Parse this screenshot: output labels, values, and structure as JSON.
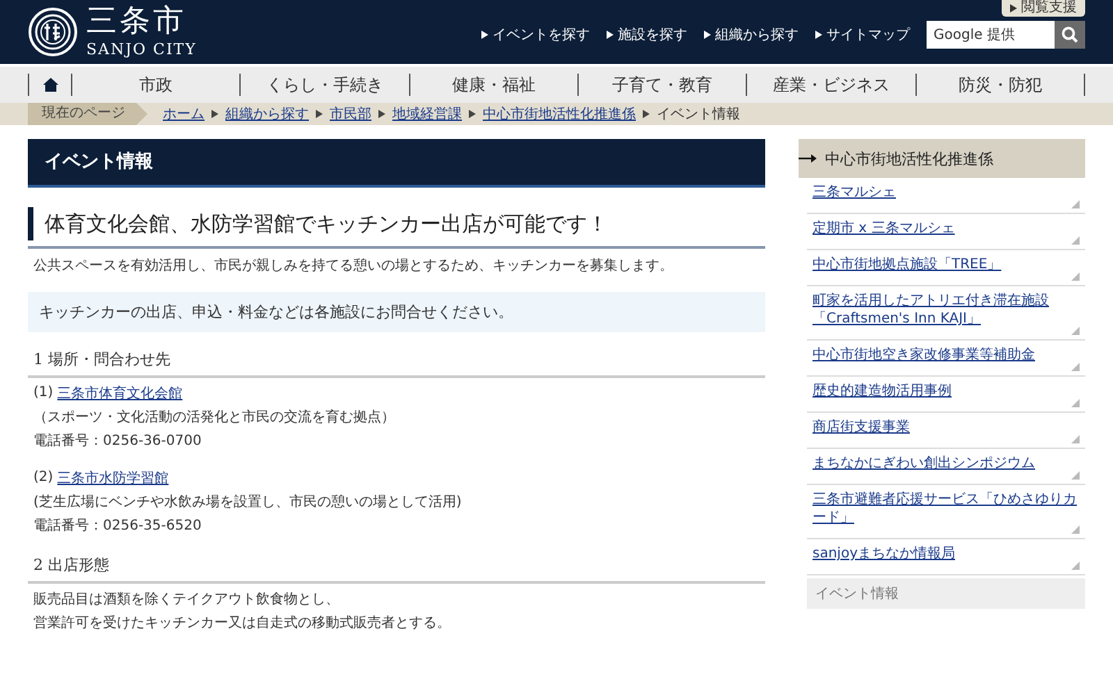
{
  "header": {
    "city_name": "三条市",
    "city_name_roman": "SANJO CITY",
    "assist_button": "閲覧支援",
    "links": [
      "イベントを探す",
      "施設を探す",
      "組織から探す",
      "サイトマップ"
    ],
    "search": {
      "placeholder": "Google 提供"
    }
  },
  "nav": {
    "items": [
      {
        "kind": "home"
      },
      {
        "kind": "text",
        "label": "市政"
      },
      {
        "kind": "text",
        "label": "くらし・手続き"
      },
      {
        "kind": "text",
        "label": "健康・福祉"
      },
      {
        "kind": "text",
        "label": "子育て・教育"
      },
      {
        "kind": "text",
        "label": "産業・ビジネス"
      },
      {
        "kind": "text",
        "label": "防災・防犯"
      }
    ]
  },
  "breadcrumb": {
    "label": "現在のページ",
    "links": [
      "ホーム",
      "組織から探す",
      "市民部",
      "地域経営課",
      "中心市街地活性化推進係"
    ],
    "current": "イベント情報"
  },
  "article": {
    "page_title": "イベント情報",
    "heading": "体育文化会館、水防学習館でキッチンカー出店が可能です！",
    "intro": "公共スペースを有効活用し、市民が親しみを持てる憩いの場とするため、キッチンカーを募集します。",
    "notice": "キッチンカーの出店、申込・料金などは各施設にお問合せください。",
    "sections": [
      {
        "heading": "1 場所・問合わせ先",
        "lines": [
          {
            "kind": "link",
            "prefix": "(1)",
            "text": "三条市体育文化会館"
          },
          {
            "kind": "text",
            "text": "（スポーツ・文化活動の活発化と市民の交流を育む拠点）"
          },
          {
            "kind": "text",
            "text": "電話番号：0256-36-0700"
          },
          {
            "kind": "gap"
          },
          {
            "kind": "link",
            "prefix": "(2)",
            "text": "三条市水防学習館"
          },
          {
            "kind": "text",
            "text": "(芝生広場にベンチや水飲み場を設置し、市民の憩いの場として活用)"
          },
          {
            "kind": "text",
            "text": "電話番号：0256-35-6520"
          }
        ]
      },
      {
        "heading": "2 出店形態",
        "lines": [
          {
            "kind": "text",
            "text": "販売品目は酒類を除くテイクアウト飲食物とし、"
          },
          {
            "kind": "text",
            "text": "営業許可を受けたキッチンカー又は自走式の移動式販売者とする。"
          }
        ]
      }
    ]
  },
  "sidebar": {
    "title": "中心市街地活性化推進係",
    "items": [
      "三条マルシェ",
      "定期市 x 三条マルシェ",
      "中心市街地拠点施設「TREE」",
      "町家を活用したアトリエ付き滞在施設「Craftsmen's Inn KAJI」",
      "中心市街地空き家改修事業等補助金",
      "歴史的建造物活用事例",
      "商店街支援事業",
      "まちなかにぎわい創出シンポジウム",
      "三条市避難者応援サービス「ひめさゆりカード」",
      "sanjoyまちなか情報局"
    ],
    "bottom_title": "イベント情報"
  }
}
